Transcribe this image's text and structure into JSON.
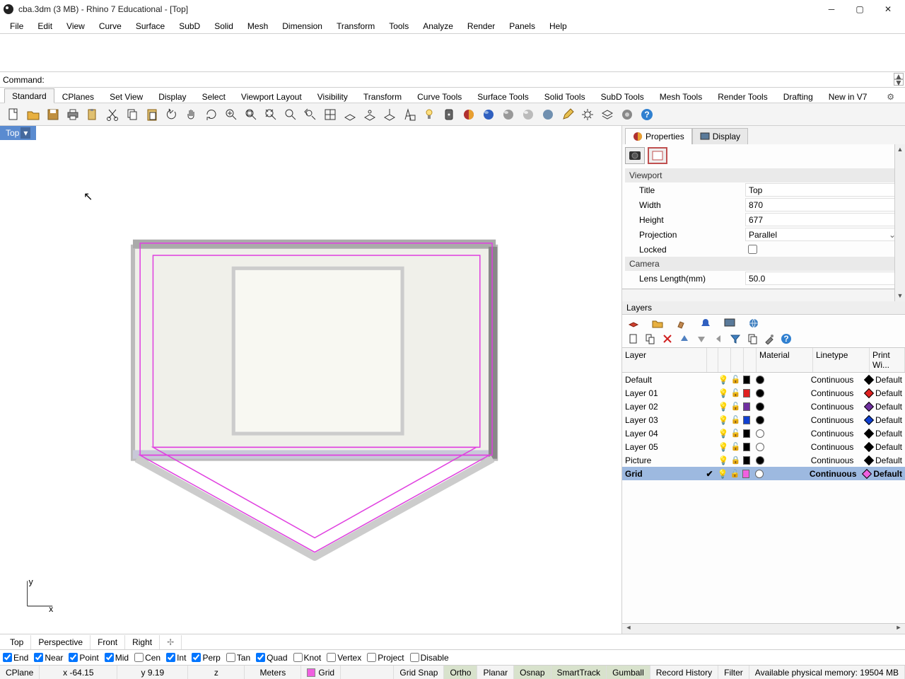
{
  "title": "cba.3dm (3 MB) - Rhino 7 Educational - [Top]",
  "menu": [
    "File",
    "Edit",
    "View",
    "Curve",
    "Surface",
    "SubD",
    "Solid",
    "Mesh",
    "Dimension",
    "Transform",
    "Tools",
    "Analyze",
    "Render",
    "Panels",
    "Help"
  ],
  "command_label": "Command:",
  "toolbar_tabs": [
    "Standard",
    "CPlanes",
    "Set View",
    "Display",
    "Select",
    "Viewport Layout",
    "Visibility",
    "Transform",
    "Curve Tools",
    "Surface Tools",
    "Solid Tools",
    "SubD Tools",
    "Mesh Tools",
    "Render Tools",
    "Drafting",
    "New in V7"
  ],
  "viewport_tab": "Top",
  "rp_tabs": {
    "properties": "Properties",
    "display": "Display"
  },
  "viewport_section": "Viewport",
  "camera_section": "Camera",
  "props": {
    "title_l": "Title",
    "title_v": "Top",
    "width_l": "Width",
    "width_v": "870",
    "height_l": "Height",
    "height_v": "677",
    "proj_l": "Projection",
    "proj_v": "Parallel",
    "locked_l": "Locked",
    "lens_l": "Lens Length(mm)",
    "lens_v": "50.0"
  },
  "layers_label": "Layers",
  "layer_cols": {
    "layer": "Layer",
    "material": "Material",
    "linetype": "Linetype",
    "printw": "Print Wi..."
  },
  "layers": [
    {
      "name": "Default",
      "color": "#000000",
      "mat_fill": "#000",
      "lt": "Continuous",
      "pw": "Default",
      "lock": "open"
    },
    {
      "name": "Layer 01",
      "color": "#e02020",
      "mat_fill": "#000",
      "lt": "Continuous",
      "pw": "Default",
      "lock": "open"
    },
    {
      "name": "Layer 02",
      "color": "#7030a0",
      "mat_fill": "#000",
      "lt": "Continuous",
      "pw": "Default",
      "lock": "open"
    },
    {
      "name": "Layer 03",
      "color": "#1040d0",
      "mat_fill": "#000",
      "lt": "Continuous",
      "pw": "Default",
      "lock": "open"
    },
    {
      "name": "Layer 04",
      "color": "#000000",
      "mat_fill": "none",
      "lt": "Continuous",
      "pw": "Default",
      "lock": "open"
    },
    {
      "name": "Layer 05",
      "color": "#000000",
      "mat_fill": "none",
      "lt": "Continuous",
      "pw": "Default",
      "lock": "open"
    },
    {
      "name": "Picture",
      "color": "#000000",
      "mat_fill": "#000",
      "lt": "Continuous",
      "pw": "Default",
      "lock": "closed"
    },
    {
      "name": "Grid",
      "color": "#f060e0",
      "mat_fill": "#fff",
      "lt": "Continuous",
      "pw": "Default",
      "lock": "open",
      "sel": true,
      "check": true
    }
  ],
  "viewtabs": [
    "Top",
    "Perspective",
    "Front",
    "Right"
  ],
  "osnaps": [
    {
      "l": "End",
      "c": true
    },
    {
      "l": "Near",
      "c": true
    },
    {
      "l": "Point",
      "c": true
    },
    {
      "l": "Mid",
      "c": true
    },
    {
      "l": "Cen",
      "c": false
    },
    {
      "l": "Int",
      "c": true
    },
    {
      "l": "Perp",
      "c": true
    },
    {
      "l": "Tan",
      "c": false
    },
    {
      "l": "Quad",
      "c": true
    },
    {
      "l": "Knot",
      "c": false
    },
    {
      "l": "Vertex",
      "c": false
    },
    {
      "l": "Project",
      "c": false
    },
    {
      "l": "Disable",
      "c": false
    }
  ],
  "status": {
    "cplane": "CPlane",
    "x": "x -64.15",
    "y": "y 9.19",
    "z": "z",
    "units": "Meters",
    "layer": "Grid",
    "toggles": [
      "Grid Snap",
      "Ortho",
      "Planar",
      "Osnap",
      "SmartTrack",
      "Gumball",
      "Record History",
      "Filter"
    ],
    "toggles_on": [
      false,
      true,
      false,
      true,
      true,
      true,
      false,
      false
    ],
    "mem": "Available physical memory: 19504 MB"
  }
}
